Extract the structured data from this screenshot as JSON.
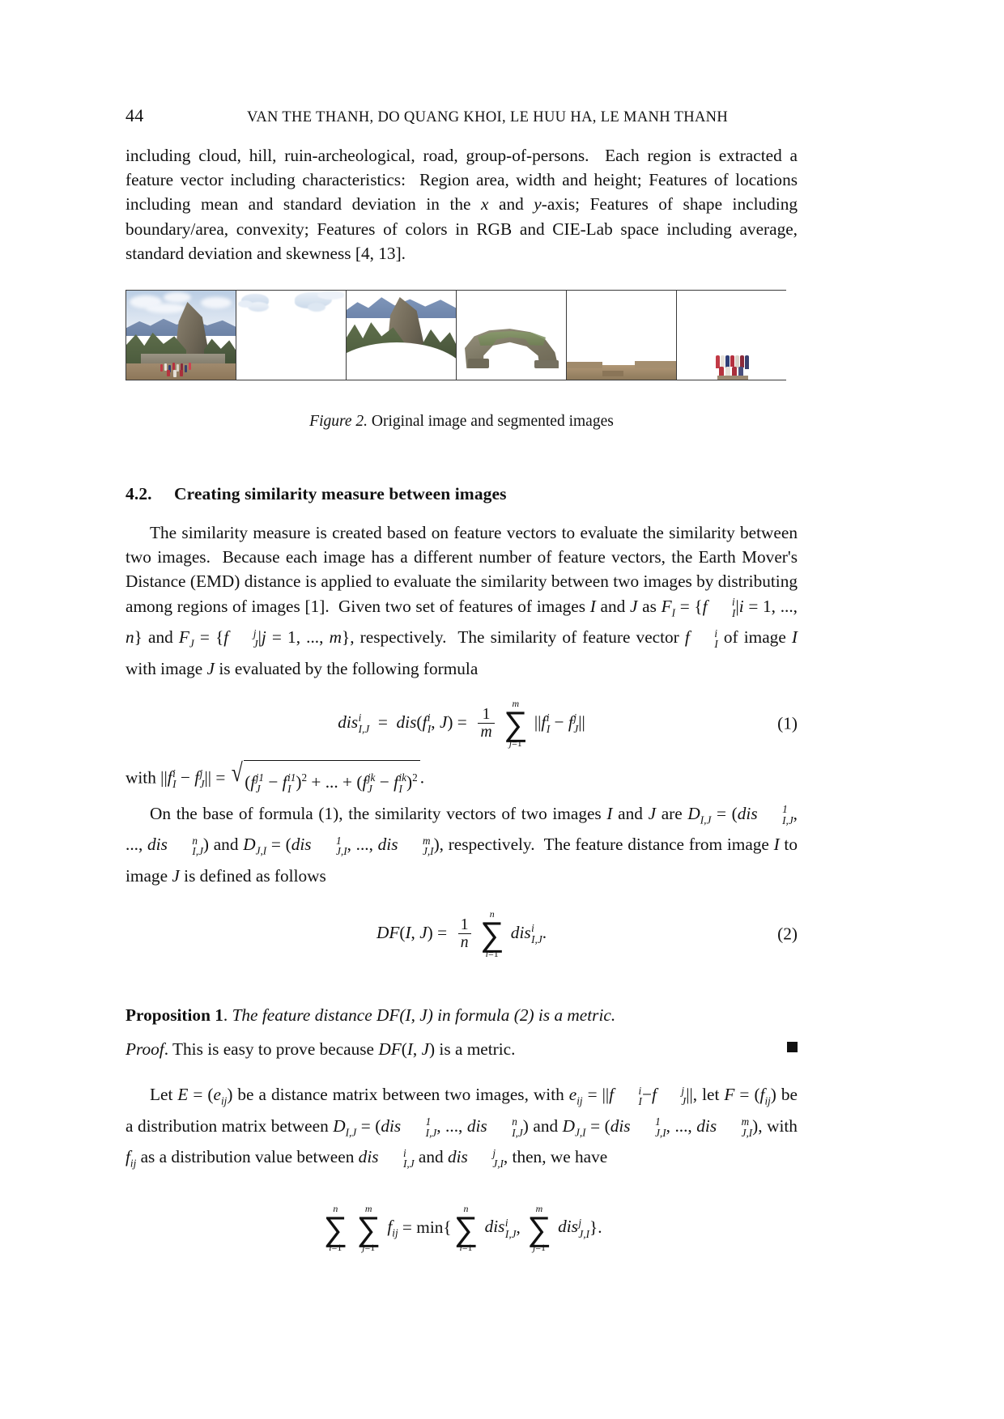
{
  "header": {
    "folio": "44",
    "running_title": "VAN THE THANH, DO QUANG KHOI, LE HUU HA, LE MANH THANH"
  },
  "paragraph_1": "including cloud, hill, ruin-archeological, road, group-of-persons. Each region is extracted a feature vector including characteristics: Region area, width and height; Features of locations including mean and standard deviation in the x and y-axis; Features of shape including boundary/area, convexity; Features of colors in RGB and CIE-Lab space including average, standard deviation and skewness [4, 13].",
  "figure": {
    "caption_label": "Figure 2.",
    "caption_text": "Original image and segmented images",
    "panels": [
      {
        "name": "original-image",
        "alt": "original photo of mountain ruin with people"
      },
      {
        "name": "segment-cloud",
        "alt": "cloud segment"
      },
      {
        "name": "segment-hill",
        "alt": "hill segment"
      },
      {
        "name": "segment-ruin-archeological",
        "alt": "ruin archeological segment"
      },
      {
        "name": "segment-road",
        "alt": "road segment"
      },
      {
        "name": "segment-group-of-persons",
        "alt": "group of persons segment"
      }
    ]
  },
  "section": {
    "number": "4.2.",
    "title": "Creating similarity measure between images"
  },
  "paragraph_2": {
    "line1": "The similarity measure is created based on feature vectors to evaluate the similarity",
    "line2": "between two images. Because each image has a different number of feature vectors, the",
    "line3": "Earth Mover's Distance (EMD) distance is applied to evaluate the similarity between two",
    "line4a": "images by distributing among regions of images [1]. Given two set of features of images ",
    "line4b": "I",
    "line5_pre": "and ",
    "line5_J": "J",
    "line5_as": " as ",
    "line5_tail": ", respectively. The similarity of",
    "line6_pre": "feature vector ",
    "line6_mid": " of image ",
    "line6_I": "I",
    "line6_with": " with image ",
    "line6_J": "J",
    "line6_tail": " is evaluated by the following formula"
  },
  "equation_1": {
    "tag": "(1)",
    "lhs": "dis",
    "lhs_sub": "I,J",
    "lhs_sup": "i",
    "eq": "=",
    "fn": "dis(",
    "fn_arg1": "f",
    "fn_arg1_sub": "I",
    "fn_arg1_sup": "i",
    "fn_arg2": ", J)",
    "frac_num": "1",
    "frac_den": "m",
    "sum_symbol": "∑",
    "sum_lower": "j=1",
    "sum_upper": "m",
    "body_open": "||",
    "body_f1": "f",
    "body_f1_sub": "I",
    "body_f1_sup": "i",
    "body_minus": "−",
    "body_f2": "f",
    "body_f2_sub": "J",
    "body_f2_sup": "j",
    "body_close": "||"
  },
  "with_line": {
    "prefix": "with ",
    "norm_open": "||",
    "f1": "f",
    "f1_sub": "I",
    "f1_sup": "i",
    "minus": "−",
    "f2": "f",
    "f2_sub": "J",
    "f2_sup": "j",
    "norm_close": "||",
    "eq": "=",
    "radical": "√",
    "term1_f": "f",
    "term1_sub": "J",
    "term1_sup": "j1",
    "term1_minus": "−",
    "term1_g": "f",
    "term1_g_sub": "I",
    "term1_g_sup": "i1",
    "power": "2",
    "plus_dots": "+ ... +",
    "term2_f": "f",
    "term2_sub": "J",
    "term2_sup": "jk",
    "term2_minus": "−",
    "term2_g": "f",
    "term2_g_sub": "I",
    "term2_g_sup": "ik",
    "period": "."
  },
  "paragraph_3": {
    "l1": "On the base of formula (1), the similarity vectors of two images ",
    "l1_I": "I",
    "l1_and": " and ",
    "l1_J": "J",
    "l1_are": " are ",
    "l1_D": "D",
    "l1_D_sub": "I,J",
    "l1_eq": " =",
    "l2_tail": ", respectively. The feature distance from image",
    "l3": " to image ",
    "l3_I": "I",
    "l3_J": "J",
    "l3_tail": " is defined as follows"
  },
  "equation_2": {
    "tag": "(2)",
    "lhs": "DF(I, J)",
    "eq": "=",
    "frac_num": "1",
    "frac_den": "n",
    "sum_symbol": "∑",
    "sum_lower": "i=1",
    "sum_upper": "n",
    "body": "dis",
    "body_sub": "I,J",
    "body_sup": "i",
    "period": "."
  },
  "proposition": {
    "label": "Proposition 1",
    "period": ".",
    "text": "The feature distance DF(I, J) in formula (2) is a metric."
  },
  "proof": {
    "label": "Proof",
    "period": ".",
    "text_pre": " This is easy to prove because ",
    "text_math": "DF(I, J)",
    "text_post": " is a metric.",
    "qed_symbol": "■"
  },
  "paragraph_4": {
    "l1_pre": "Let ",
    "l1_E": "E",
    "l1_eq": " = (",
    "l1_e": "e",
    "l1_e_sub": "ij",
    "l1_close": ")",
    "l1_mid": " be a distance matrix between two images, with ",
    "l1_eij": "e",
    "l1_eij_sub": "ij",
    "l1_tail": ", let ",
    "l1_F": "F",
    "l1_F_eq": " = (",
    "l1_fij": "f",
    "l1_fij_sub": "ij",
    "l1_F_close": ")",
    "l2_pre": "be a distribution matrix between ",
    "l2_tail": ", with",
    "l3_pre": " as a distribution value between ",
    "l3_tail": ", then, we have"
  },
  "equation_3": {
    "sum1_symbol": "∑",
    "sum1_lower": "i=1",
    "sum1_upper": "n",
    "sum2_symbol": "∑",
    "sum2_lower": "j=1",
    "sum2_upper": "m",
    "f": "f",
    "f_sub": "ij",
    "eq": "=",
    "min": "min{",
    "sum3_symbol": "∑",
    "sum3_lower": "i=1",
    "sum3_upper": "n",
    "dis1": "dis",
    "dis1_sub": "I,J",
    "dis1_sup": "i",
    "comma": ",",
    "sum4_symbol": "∑",
    "sum4_lower": "j=1",
    "sum4_upper": "m",
    "dis2": "dis",
    "dis2_sub": "J,I",
    "dis2_sup": "j",
    "close": "}."
  },
  "colors": {
    "text": "#111111",
    "rule": "#3a3a3a",
    "sky": "#b9cde4",
    "rock": "#8d8472",
    "vegetation": "#5c6a52",
    "ground": "#a08a6e"
  }
}
